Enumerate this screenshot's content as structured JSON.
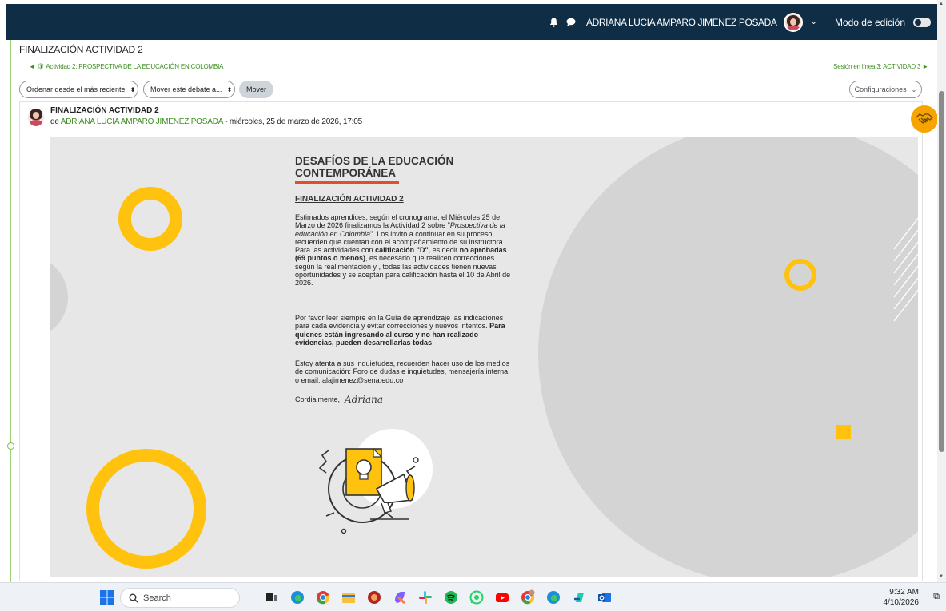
{
  "navbar": {
    "user_name": "ADRIANA LUCIA AMPARO JIMENEZ POSADA",
    "edit_mode_label": "Modo de edición",
    "icons": [
      "bell-icon",
      "chat-icon",
      "chevron-down-icon"
    ],
    "bg_color": "#0f2d45"
  },
  "page": {
    "title": "FINALIZACIÓN ACTIVIDAD 2",
    "prev_link": "◄ 🛡 Actividad 2: PROSPECTIVA DE LA EDUCACIÓN EN COLOMBIA",
    "next_link": "Sesión en línea 3: ACTIVIDAD 3 ►"
  },
  "controls": {
    "sort_select": "Ordenar desde el más reciente",
    "move_select": "Mover este debate a...",
    "move_button": "Mover",
    "config_button": "Configuraciones"
  },
  "post": {
    "title": "FINALIZACIÓN ACTIVIDAD 2",
    "by": "de",
    "author": "ADRIANA LUCIA AMPARO JIMENEZ POSADA",
    "date": " - miércoles, 25 de marzo de 2026, 17:05",
    "link_color": "#3e8e22"
  },
  "banner": {
    "title": "DESAFÍOS DE LA EDUCACIÓN CONTEMPORÁNEA",
    "subtitle": "FINALIZACIÓN ACTIVIDAD 2",
    "p1": {
      "a": "Estimados aprendices, según el cronograma, el Miércoles 25 de Marzo de 2026  finalizamos la  Actividad 2 sobre \"",
      "italic": "Prospectiva de la educación en Colombia",
      "b": "\". Los invito a continuar en su proceso, recuerden que cuentan con el acompañamiento de su instructora.",
      "c": "Para las actividades con ",
      "bold1": "calificación \"D\"",
      "d": ", es decir ",
      "bold2": "no aprobadas (69 puntos o menos)",
      "e": ", es necesario que realicen correcciones según la realimentación y , todas las actividades tienen nuevas oportunidades y se aceptan para calificación hasta el 10 de Abril de 2026."
    },
    "p2": {
      "a": "Por favor leer siempre en la Guía de aprendizaje las indicaciones para cada evidencia y evitar correcciones y nuevos intentos. ",
      "bold": "Para quienes están ingresando al curso y no han realizado evidencias, pueden desarrollarlas todas",
      "b": "."
    },
    "p3": "Estoy atenta a sus inquietudes, recuerden  hacer uso de los medios de comunicación: Foro de dudas e inquietudes, mensajería interna o email: alajimenez@sena.edu.co",
    "closing": "Cordialmente,",
    "signature": "Adriana",
    "accent_yellow": "#ffc20e",
    "accent_red": "#e04e2c"
  },
  "taskbar": {
    "search_placeholder": "Search",
    "time": "9:32 AM",
    "date": "4/10/2026"
  }
}
